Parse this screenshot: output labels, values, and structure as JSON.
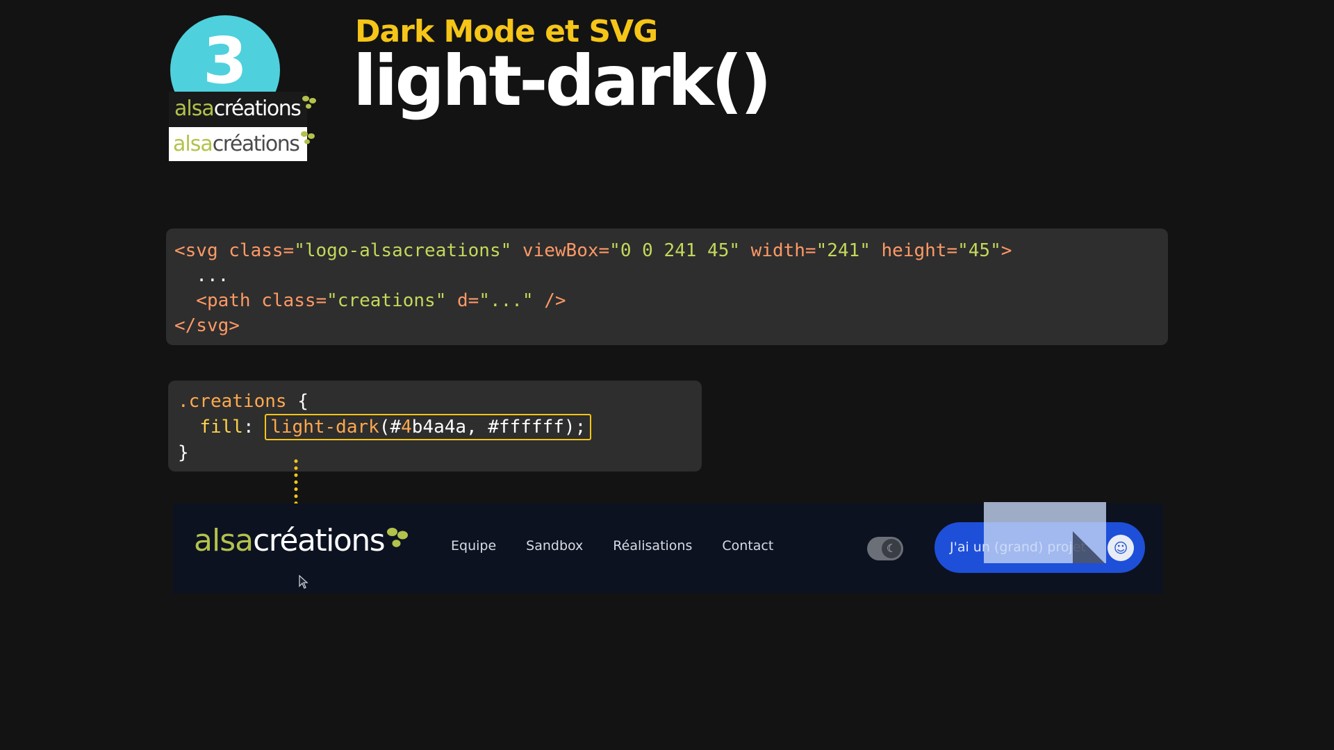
{
  "slide": {
    "number": "3",
    "subtitle": "Dark Mode et SVG",
    "title": "light-dark()"
  },
  "logo": {
    "alsa": "alsa",
    "creations": "créations"
  },
  "code_svg": {
    "line1_open": "<svg",
    "line1_attr1": " class=",
    "line1_val1": "\"logo-alsacreations\"",
    "line1_attr2": " viewBox=",
    "line1_val2": "\"0 0 241 45\"",
    "line1_attr3": " width=",
    "line1_val3": "\"241\"",
    "line1_attr4": " height=",
    "line1_val4": "\"45\"",
    "line1_close": ">",
    "line2": "  ...",
    "line3_open": "  <path",
    "line3_attr1": " class=",
    "line3_val1": "\"creations\"",
    "line3_attr2": " d=",
    "line3_val2": "\"...\"",
    "line3_close": " />",
    "line4": "</svg>"
  },
  "code_css": {
    "selector": ".creations",
    "brace_open": " {",
    "indent": "  ",
    "property": "fill",
    "colon": ": ",
    "fn": "light-dark",
    "paren_open": "(#",
    "num": "4",
    "rest": "b4a4a, #ffffff);",
    "brace_close": "}"
  },
  "website": {
    "logo_alsa": "alsa",
    "logo_creations": "créations",
    "nav": [
      "Equipe",
      "Sandbox",
      "Réalisations",
      "Contact"
    ],
    "cta_label": "J'ai un (grand) projet",
    "toggle_icon": "moon-icon",
    "cta_icon": "smile-icon"
  },
  "colors": {
    "background": "#131313",
    "accent_yellow": "#f5c518",
    "badge_cyan": "#4fd0dd",
    "logo_green": "#b3c24b",
    "logo_gray": "#4b4a4a",
    "cta_blue": "#1e4fd8"
  }
}
